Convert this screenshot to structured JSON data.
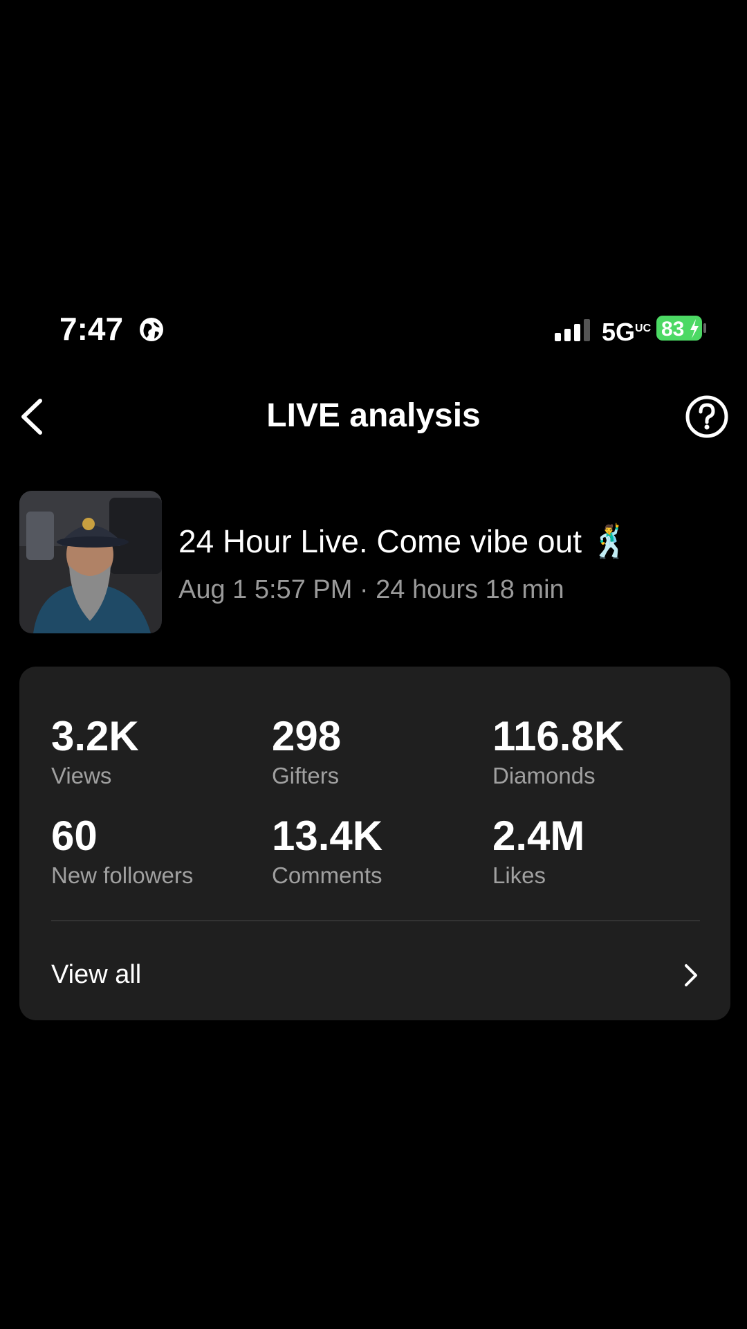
{
  "status_bar": {
    "time": "7:47",
    "network": "5G",
    "network_suffix": "UC",
    "battery": "83"
  },
  "header": {
    "title": "LIVE analysis"
  },
  "live": {
    "title": "24 Hour Live. Come vibe out 🕺",
    "meta": "Aug 1 5:57 PM · 24 hours 18 min"
  },
  "stats": [
    {
      "value": "3.2K",
      "label": "Views"
    },
    {
      "value": "298",
      "label": "Gifters"
    },
    {
      "value": "116.8K",
      "label": "Diamonds"
    },
    {
      "value": "60",
      "label": "New followers"
    },
    {
      "value": "13.4K",
      "label": "Comments"
    },
    {
      "value": "2.4M",
      "label": "Likes"
    }
  ],
  "view_all": "View all",
  "colors": {
    "background": "#000000",
    "card": "#1f1f1f",
    "battery": "#4cd964",
    "muted_text": "#9a9a9a"
  },
  "icons": [
    "globe-icon",
    "signal-icon",
    "battery-icon",
    "back-arrow-icon",
    "help-icon",
    "chevron-right-icon"
  ]
}
